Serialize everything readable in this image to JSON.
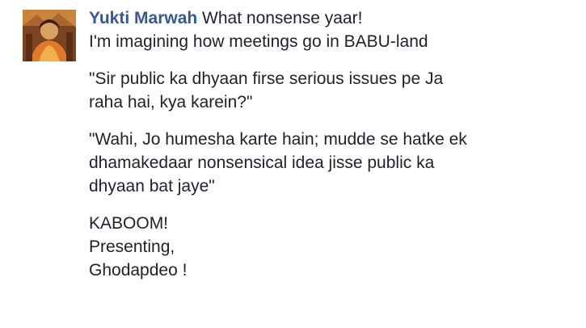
{
  "comment": {
    "author_name": "Yukti Marwah",
    "avatar_icon": "profile-photo",
    "colors": {
      "author": "#365899",
      "text": "#1d2129",
      "background": "#ffffff"
    },
    "lines": [
      "What nonsense yaar!",
      "I'm imagining how meetings go in BABU-land",
      "\"Sir public ka dhyaan firse serious issues pe Ja",
      "raha hai, kya karein?\"",
      "\"Wahi, Jo humesha karte hain; mudde se hatke ek",
      "dhamakedaar nonsensical idea jisse public ka",
      "dhyaan bat jaye\"",
      "KABOOM!",
      "Presenting,",
      "Ghodapdeo !"
    ]
  }
}
